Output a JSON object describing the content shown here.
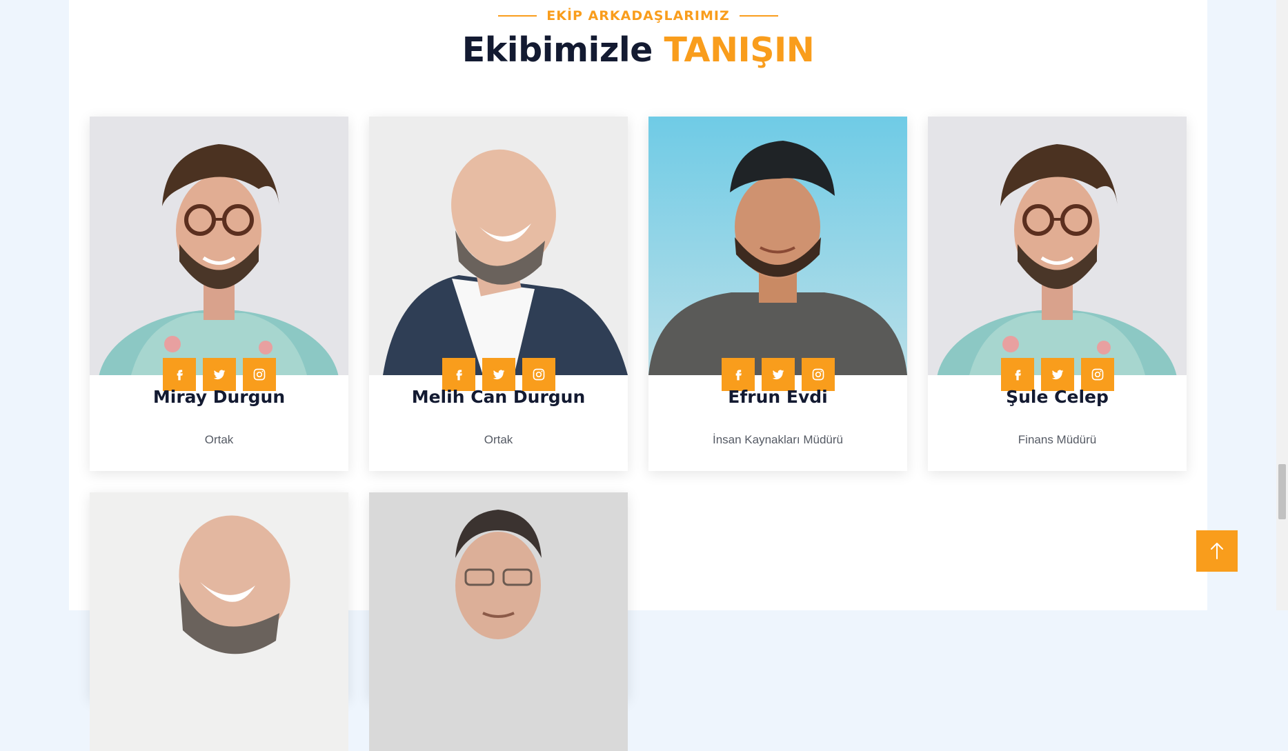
{
  "section": {
    "eyebrow": "EKİP ARKADAŞLARIMIZ",
    "title_main": "Ekibimizle",
    "title_accent": "TANIŞIN"
  },
  "colors": {
    "accent": "#f99d1c",
    "heading": "#131a31",
    "text": "#555a64"
  },
  "members": [
    {
      "name": "Miray Durgun",
      "role": "Ortak",
      "socials": [
        "facebook-icon",
        "twitter-icon",
        "instagram-icon"
      ]
    },
    {
      "name": "Melih Can Durgun",
      "role": "Ortak",
      "socials": [
        "facebook-icon",
        "twitter-icon",
        "instagram-icon"
      ]
    },
    {
      "name": "Efrun Evdi",
      "role": "İnsan Kaynakları Müdürü",
      "socials": [
        "facebook-icon",
        "twitter-icon",
        "instagram-icon"
      ]
    },
    {
      "name": "Şule Celep",
      "role": "Finans Müdürü",
      "socials": [
        "facebook-icon",
        "twitter-icon",
        "instagram-icon"
      ]
    }
  ],
  "back_to_top_icon": "arrow-up-icon"
}
